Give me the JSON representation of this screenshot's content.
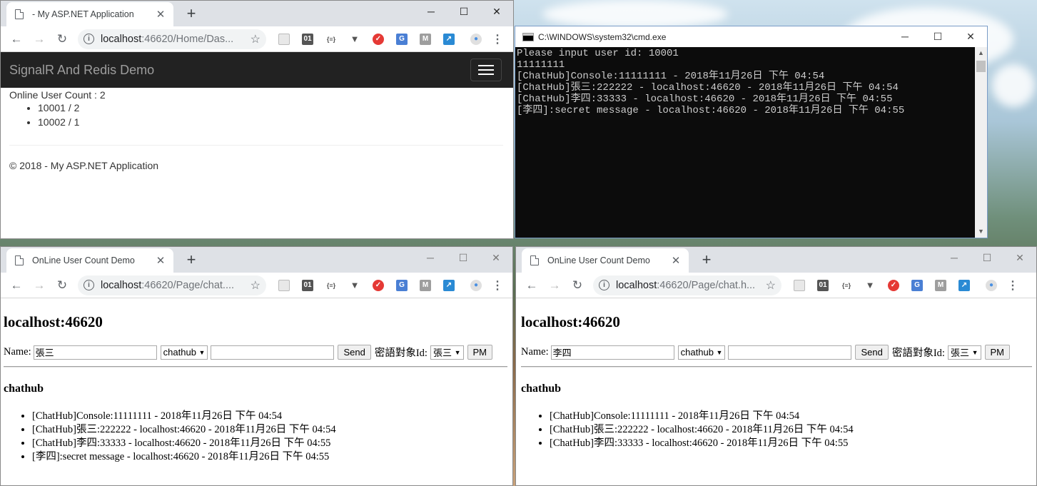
{
  "colors": {
    "navbar_bg": "#222222",
    "cmd_bg": "#0c0c0c",
    "cmd_text": "#cccccc",
    "tabstrip": "#dee1e6"
  },
  "win1": {
    "tab_title": "- My ASP.NET Application",
    "url_host": "localhost",
    "url_path": ":46620/Home/Das...",
    "brand": "SignalR And Redis Demo",
    "online_label": "Online User Count : 2",
    "users": [
      "10001 / 2",
      "10002 / 1"
    ],
    "footer": "© 2018 - My ASP.NET Application"
  },
  "cmd": {
    "title": "C:\\WINDOWS\\system32\\cmd.exe",
    "lines": [
      "Please input user id: 10001",
      "11111111",
      "[ChatHub]Console:11111111 - 2018年11月26日 下午 04:54",
      "[ChatHub]張三:222222 - localhost:46620 - 2018年11月26日 下午 04:54",
      "[ChatHub]李四:33333 - localhost:46620 - 2018年11月26日 下午 04:55",
      "[李四]:secret message - localhost:46620 - 2018年11月26日 下午 04:55"
    ]
  },
  "win2": {
    "tab_title": "OnLine User Count Demo",
    "url_host": "localhost",
    "url_path": ":46620/Page/chat....",
    "heading": "localhost:46620",
    "name_label": "Name:",
    "name_value": "張三",
    "hub_select": "chathub",
    "send_label": "Send",
    "pm_target_label": "密語對象Id:",
    "pm_target_value": "張三",
    "pm_label": "PM",
    "hub_heading": "chathub",
    "messages": [
      "[ChatHub]Console:11111111 - 2018年11月26日 下午 04:54",
      "[ChatHub]張三:222222 - localhost:46620 - 2018年11月26日 下午 04:54",
      "[ChatHub]李四:33333 - localhost:46620 - 2018年11月26日 下午 04:55",
      "[李四]:secret message - localhost:46620 - 2018年11月26日 下午 04:55"
    ]
  },
  "win3": {
    "tab_title": "OnLine User Count Demo",
    "url_host": "localhost",
    "url_path": ":46620/Page/chat.h...",
    "heading": "localhost:46620",
    "name_label": "Name:",
    "name_value": "李四",
    "hub_select": "chathub",
    "send_label": "Send",
    "pm_target_label": "密語對象Id:",
    "pm_target_value": "張三",
    "pm_label": "PM",
    "hub_heading": "chathub",
    "messages": [
      "[ChatHub]Console:11111111 - 2018年11月26日 下午 04:54",
      "[ChatHub]張三:222222 - localhost:46620 - 2018年11月26日 下午 04:54",
      "[ChatHub]李四:33333 - localhost:46620 - 2018年11月26日 下午 04:55"
    ]
  }
}
